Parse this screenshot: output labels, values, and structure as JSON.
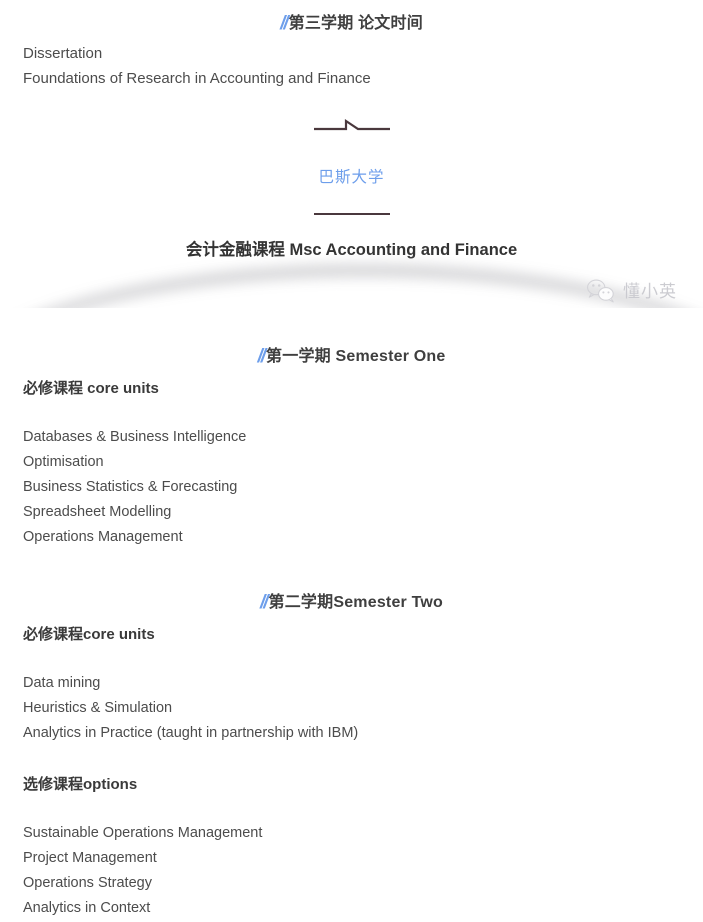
{
  "colors": {
    "accent_blue": "#6d9eeb",
    "heading_dark": "#3f3f3f",
    "body_gray": "#4c4c4c",
    "rule_dark": "#4a383d",
    "watermark_gray": "#c8c8ce"
  },
  "semester_three": {
    "slash": "//",
    "heading": "第三学期  论文时间",
    "courses": [
      "Dissertation",
      "Foundations of Research in Accounting and Finance"
    ]
  },
  "badge": {
    "icon": "flag-rule-icon",
    "university": "巴斯大学"
  },
  "main_title": "会计金融课程 Msc Accounting and Finance",
  "watermark": {
    "icon": "wechat-icon",
    "account_name": "懂小英"
  },
  "semester_one": {
    "slash": "//",
    "heading": "第一学期 Semester One",
    "core_label": "必修课程 core units",
    "courses": [
      "Databases & Business Intelligence",
      "Optimisation",
      "Business Statistics & Forecasting",
      "Spreadsheet Modelling",
      "Operations Management"
    ]
  },
  "semester_two": {
    "slash": "//",
    "heading": "第二学期Semester Two",
    "core_label": "必修课程core units",
    "core_courses": [
      "Data mining",
      "Heuristics & Simulation",
      "Analytics in Practice (taught in partnership with IBM)"
    ],
    "options_label": "选修课程options",
    "option_courses": [
      "Sustainable Operations Management",
      "Project Management",
      "Operations Strategy",
      "Analytics in Context"
    ]
  }
}
